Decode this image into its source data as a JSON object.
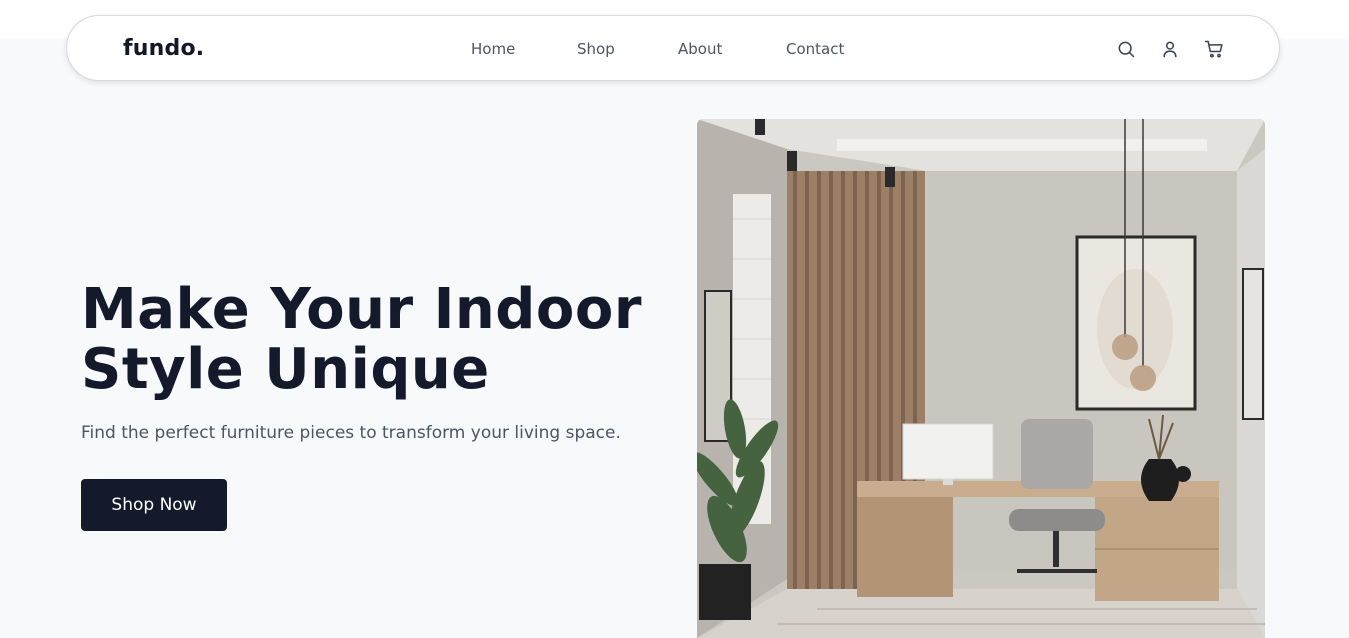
{
  "brand": {
    "logo": "fundo."
  },
  "nav": {
    "links": [
      {
        "label": "Home"
      },
      {
        "label": "Shop"
      },
      {
        "label": "About"
      },
      {
        "label": "Contact"
      }
    ],
    "icons": [
      "search-icon",
      "user-icon",
      "cart-icon"
    ]
  },
  "hero": {
    "title_line1": "Make Your Indoor",
    "title_line2": "Style Unique",
    "subtitle": "Find the perfect furniture pieces to transform your living space.",
    "cta_label": "Shop Now"
  },
  "colors": {
    "page_bg": "#f8f9fb",
    "primary": "#141a2b",
    "text_muted": "#4b5563",
    "white": "#ffffff"
  }
}
